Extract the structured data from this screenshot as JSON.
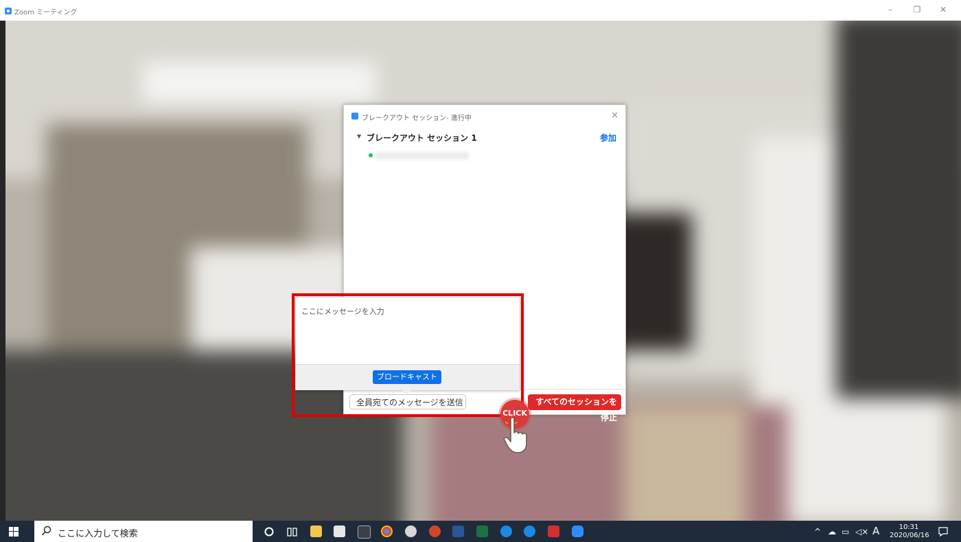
{
  "window": {
    "title": "Zoom ミーティング",
    "controls": {
      "minimize": "–",
      "restore": "❐",
      "close": "✕"
    }
  },
  "dialog": {
    "title": "ブレークアウト セッション- 進行中",
    "close_glyph": "✕",
    "session": {
      "caret": "▼",
      "name": "ブレークアウト セッション 1",
      "join_label": "参加"
    },
    "send_dropdown_label": "全員宛てのメッセージを送信 ⌵",
    "stop_all_label": "すべてのセッションを停止"
  },
  "broadcast": {
    "placeholder": "ここにメッセージを入力",
    "button_label": "ブロードキャスト"
  },
  "annotation": {
    "click_label": "CLICK"
  },
  "taskbar": {
    "search_placeholder": "ここに入力して検索",
    "clock_time": "10:31",
    "clock_date": "2020/06/16",
    "ime_label": "A"
  },
  "colors": {
    "zoom_blue": "#0e71eb",
    "stop_red": "#e02828",
    "highlight_red": "#e00000",
    "taskbar": "#1f2b3a"
  },
  "icons": [
    "app-icon",
    "close-icon",
    "caret-icon",
    "participant-status-icon",
    "hand-pointer-icon",
    "windows-start-icon",
    "search-icon",
    "cortana-icon",
    "task-view-icon",
    "file-explorer-icon",
    "chrome-icon",
    "word-icon",
    "excel-icon",
    "edge-icon",
    "ie-icon",
    "acrobat-icon",
    "zoom-icon",
    "notification-icon"
  ]
}
